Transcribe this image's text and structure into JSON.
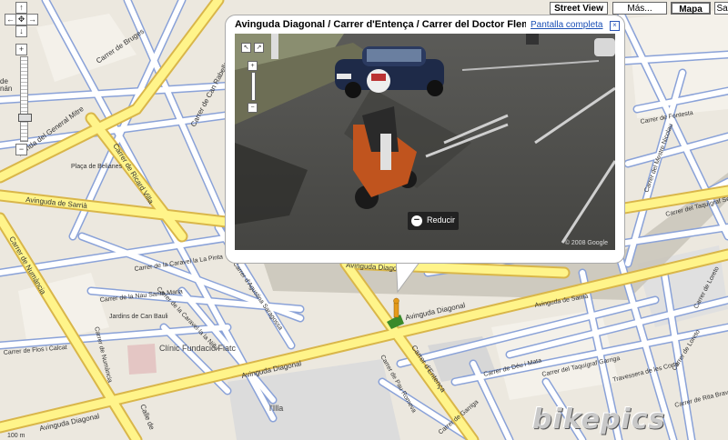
{
  "map_type_buttons": {
    "street_view": "Street View",
    "mas": "Más...",
    "mapa": "Mapa",
    "sat": "Sat"
  },
  "nav": {
    "pan_up": "↑",
    "pan_left": "←",
    "pan_home": "✥",
    "pan_right": "→",
    "pan_down": "↓",
    "zoom_in": "+",
    "zoom_out": "−"
  },
  "popup": {
    "title": "Avinguda Diagonal / Carrer d'Entença / Carrer del Doctor Fleming",
    "fullscreen_link": "Pantalla completa",
    "close": "×",
    "reduce_label": "Reducir",
    "reduce_icon": "−",
    "copyright": "© 2008 Google",
    "sv_nav": {
      "left": "↖",
      "right": "↗",
      "zoom_in": "+",
      "zoom_out": "−"
    }
  },
  "streets": {
    "ronda": "Ronda del General Mitre",
    "bruges": "Carrer de Bruges",
    "can_rabella": "Carrer de Can Rabella",
    "ricard_villa": "Carrer de Ricard Villa",
    "belianes": "Plaça de Belianes",
    "sarria_left": "Avinguda de Sarrià",
    "numancia": "Carrer de Numància",
    "caravel": "Carrer de la Caravel la La Pinta",
    "agustina": "Carrer d'Agustina Saragossa",
    "nau": "Carrer de la Nau Santa Maria",
    "caravel_nina": "Carrer de la Caravel·la la Niña",
    "can_bauli": "Jardins de Can Bauli",
    "flos": "Carrer de Flos i Calcat",
    "clinic": "Clínic Fundació Fiatc",
    "diag_bottom": "Avinguda Diagonal",
    "diag_mid": "Avinguda Diagonal",
    "diag_right": "Avinguda Diagonal",
    "diag_left": "Avinguda Diagonal",
    "entenca": "Carrer d'Entença",
    "pau_romeva": "Carrer de Pau Romeva",
    "deu_mata": "Carrer de Déu i Mata",
    "sarria_right": "Avinguda de Sarrià",
    "taquigraf_garriga": "Carrer del Taquígraf Garriga",
    "taquigraf_serra": "Carrer del Taquígraf Serra",
    "corts": "Travessera de les Corts",
    "loreto": "Carrer de Loreto",
    "loreto2": "Carrer de Loreto",
    "rita_bravo": "Carrer de Rita Bravo",
    "mestre_nicolau": "Carrer del Mestre Nicolau",
    "fontesta": "Carrer de Fontesta",
    "illa": "l'Illa",
    "calle": "Calle de",
    "garriga": "Carrer de Garriga",
    "taquigraf_serra2": "Carrer del Taquígraf Serra",
    "han": "nán",
    "de": "de"
  },
  "watermark": "bikepics",
  "scale": "100 m"
}
